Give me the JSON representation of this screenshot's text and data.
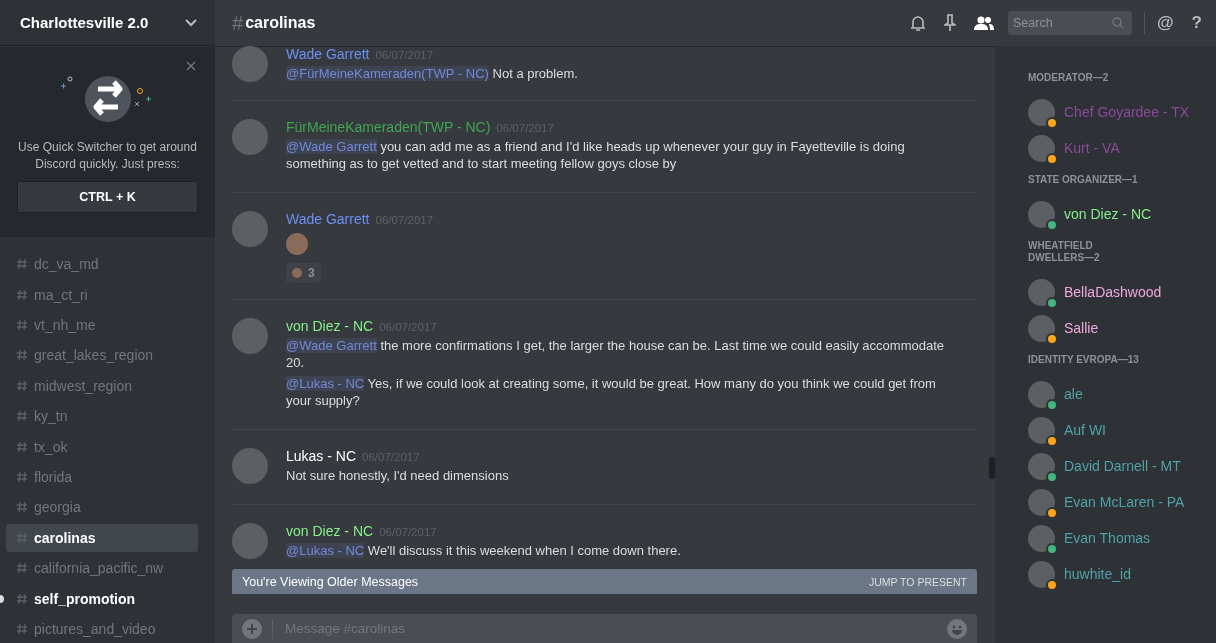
{
  "server": {
    "name": "Charlottesville 2.0"
  },
  "quick_switcher": {
    "text": "Use Quick Switcher to get around Discord quickly. Just press:",
    "key": "CTRL + K"
  },
  "channels": [
    {
      "name": "dc_va_md",
      "selected": false,
      "unread": false
    },
    {
      "name": "ma_ct_ri",
      "selected": false,
      "unread": false
    },
    {
      "name": "vt_nh_me",
      "selected": false,
      "unread": false
    },
    {
      "name": "great_lakes_region",
      "selected": false,
      "unread": false
    },
    {
      "name": "midwest_region",
      "selected": false,
      "unread": false
    },
    {
      "name": "ky_tn",
      "selected": false,
      "unread": false
    },
    {
      "name": "tx_ok",
      "selected": false,
      "unread": false
    },
    {
      "name": "florida",
      "selected": false,
      "unread": false
    },
    {
      "name": "georgia",
      "selected": false,
      "unread": false
    },
    {
      "name": "carolinas",
      "selected": true,
      "unread": false
    },
    {
      "name": "california_pacific_nw",
      "selected": false,
      "unread": false
    },
    {
      "name": "self_promotion",
      "selected": false,
      "unread": true
    },
    {
      "name": "pictures_and_video",
      "selected": false,
      "unread": false
    }
  ],
  "header": {
    "hash": "#",
    "channel": "carolinas",
    "search_placeholder": "Search",
    "mention_symbol": "@",
    "help_symbol": "?"
  },
  "messages": [
    {
      "author": "Wade Garrett",
      "color": "#6b8ff2",
      "timestamp": "06/07/2017",
      "lines": [
        {
          "mention": "@FürMeineKameraden(TWP - NC)",
          "text": "Not a problem."
        }
      ]
    },
    {
      "author": "FürMeineKameraden(TWP - NC)",
      "color": "#3fa652",
      "timestamp": "06/07/2017",
      "lines": [
        {
          "mention": "@Wade Garrett",
          "text": "you can add me as a friend and I'd like heads up whenever your guy in Fayetteville is doing something as to get vetted and to start meeting fellow goys close by"
        }
      ]
    },
    {
      "author": "Wade Garrett",
      "color": "#6b8ff2",
      "timestamp": "06/07/2017",
      "emoji": true,
      "reaction": {
        "count": "3"
      }
    },
    {
      "author": "von Diez - NC",
      "color": "#86f08b",
      "timestamp": "06/07/2017",
      "lines": [
        {
          "mention": "@Wade Garrett",
          "text": "the more confirmations I get, the larger the house can be. Last time we could easily accommodate 20."
        },
        {
          "mention": "@Lukas - NC",
          "text": "Yes, if we could look at creating some, it would be great. How many do you think we could get from your supply?"
        }
      ]
    },
    {
      "author": "Lukas - NC",
      "color": "#ffffff",
      "timestamp": "06/07/2017",
      "lines": [
        {
          "text": "Not sure honestly, I'd need dimensions"
        }
      ]
    },
    {
      "author": "von Diez - NC",
      "color": "#86f08b",
      "timestamp": "06/07/2017",
      "lines": [
        {
          "mention": "@Lukas - NC",
          "text": "We'll discuss it this weekend when I come down there."
        }
      ]
    }
  ],
  "older_banner": {
    "text": "You're Viewing Older Messages",
    "action": "JUMP TO PRESENT"
  },
  "composer": {
    "placeholder": "Message #carolinas"
  },
  "member_groups": [
    {
      "heading": "MODERATOR—2",
      "members": [
        {
          "name": "Chef Goyardee - TX",
          "color": "#8a4b9c",
          "idle": true
        },
        {
          "name": "Kurt - VA",
          "color": "#8a4b9c",
          "idle": true
        }
      ]
    },
    {
      "heading": "STATE ORGANIZER—1",
      "members": [
        {
          "name": "von Diez - NC",
          "color": "#86f08b",
          "idle": false
        }
      ]
    },
    {
      "heading": "WHEATFIELD DWELLERS—2",
      "members": [
        {
          "name": "BellaDashwood",
          "color": "#f0a8dc",
          "idle": false
        },
        {
          "name": "Sallie",
          "color": "#f0a8dc",
          "idle": true
        }
      ]
    },
    {
      "heading": "IDENTITY EVROPA—13",
      "members": [
        {
          "name": "ale",
          "color": "#4fa3a8",
          "idle": false
        },
        {
          "name": "Auf WI",
          "color": "#4fa3a8",
          "idle": true
        },
        {
          "name": "David Darnell - MT",
          "color": "#4fa3a8",
          "idle": false
        },
        {
          "name": "Evan McLaren - PA",
          "color": "#4fa3a8",
          "idle": true
        },
        {
          "name": "Evan Thomas",
          "color": "#4fa3a8",
          "idle": false
        },
        {
          "name": "huwhite_id",
          "color": "#4fa3a8",
          "idle": true
        }
      ]
    }
  ]
}
